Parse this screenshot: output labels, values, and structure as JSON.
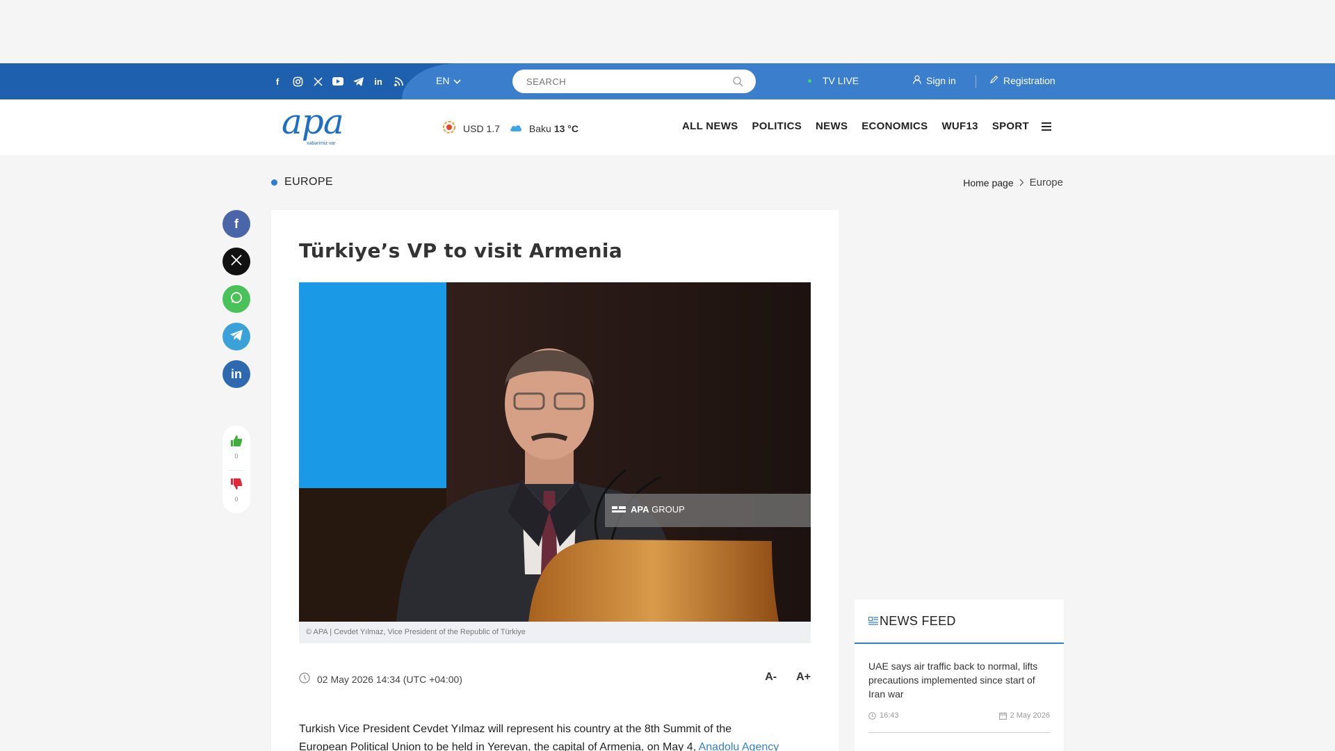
{
  "topbar": {
    "social_icons": [
      "facebook-icon",
      "instagram-icon",
      "x-icon",
      "youtube-icon",
      "telegram-icon",
      "linkedin-icon",
      "rss-icon"
    ],
    "lang": "EN",
    "search_placeholder": "SEARCH",
    "tv_live": "TV LIVE",
    "sign_in": "Sign in",
    "registration": "Registration"
  },
  "header": {
    "logo_text": "apa",
    "logo_tagline": "xəbərimiz var",
    "currency": "USD 1.7",
    "city": "Baku",
    "temperature": "13 °C",
    "nav": [
      "ALL NEWS",
      "POLITICS",
      "NEWS",
      "ECONOMICS",
      "WUF13",
      "SPORT"
    ]
  },
  "section": {
    "name": "EUROPE",
    "breadcrumb_home": "Home page",
    "breadcrumb_current": "Europe"
  },
  "share": {
    "icons": [
      "facebook-icon",
      "x-icon",
      "whatsapp-icon",
      "telegram-icon",
      "linkedin-icon"
    ],
    "likes": "0",
    "dislikes": "0"
  },
  "article": {
    "title": "Türkiye’s VP to visit Armenia",
    "watermark_bold": "APA",
    "watermark_rest": "GROUP",
    "caption": "© APA | Cevdet Yılmaz, Vice President of the Republic of Türkiye",
    "datetime": "02 May 2026 14:34 (UTC +04:00)",
    "font_decrease": "A-",
    "font_increase": "A+",
    "body_line1": "Turkish Vice President Cevdet Yılmaz will represent his country at the 8th Summit of the",
    "body_line2": "European Political Union to be held in Yerevan, the capital of Armenia, on May 4, ",
    "body_link": "Anadolu Agency"
  },
  "feed": {
    "title": "NEWS FEED",
    "items": [
      {
        "text": "UAE says air traffic back to normal, lifts precautions implemented since start of Iran war",
        "time": "16:43",
        "date": "2 May 2026"
      }
    ]
  },
  "colors": {
    "topbar_dark": "#1e5fae",
    "topbar_light": "#3b7fcc",
    "accent": "#2f7fd0"
  }
}
